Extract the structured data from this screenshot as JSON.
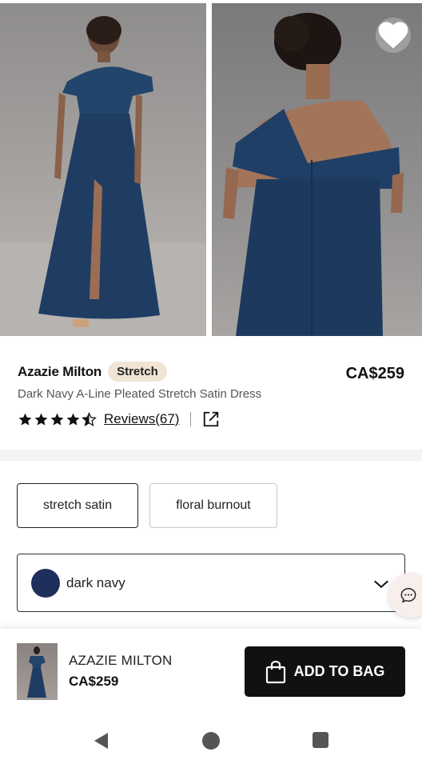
{
  "gallery": {
    "images": [
      {
        "icon": "dress-front-photo"
      },
      {
        "icon": "dress-back-photo"
      }
    ],
    "favorite_icon": "heart-icon"
  },
  "product": {
    "brand": "Azazie Milton",
    "badge": "Stretch",
    "price": "CA$259",
    "subtitle": "Dark Navy A-Line Pleated Stretch Satin Dress",
    "rating": 4.5,
    "rating_max": 5,
    "reviews_label": "Reviews(67)",
    "share_icon": "external-link-icon"
  },
  "options": {
    "fabrics": [
      "stretch satin",
      "floral burnout"
    ],
    "selected_fabric": "stretch satin",
    "color": {
      "label": "dark navy",
      "swatch": "#1f2f5c"
    },
    "chat_icon": "chat-bubble-icon"
  },
  "bottom_bar": {
    "name": "AZAZIE MILTON",
    "price": "CA$259",
    "add_label": "ADD TO BAG"
  },
  "colors": {
    "dress": "#1f3d63",
    "badge_bg": "#f0e4d4",
    "button": "#111111"
  }
}
